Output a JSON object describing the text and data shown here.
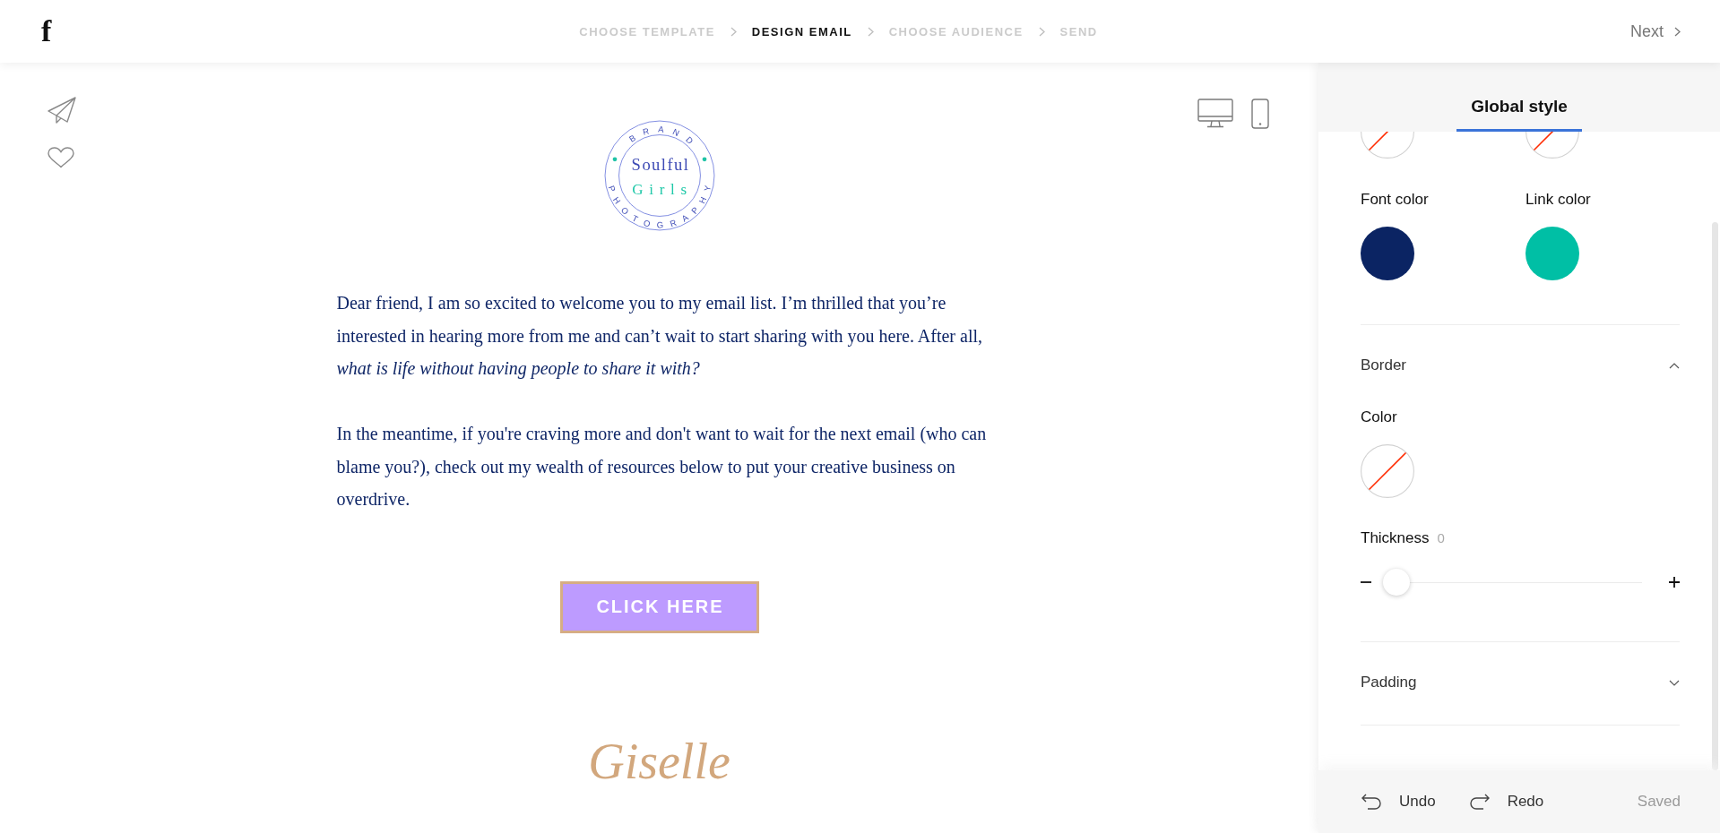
{
  "top_bar": {
    "logo": "f",
    "steps": [
      {
        "label": "CHOOSE TEMPLATE",
        "selected": false
      },
      {
        "label": "DESIGN EMAIL",
        "selected": true
      },
      {
        "label": "CHOOSE AUDIENCE",
        "selected": false
      },
      {
        "label": "SEND",
        "selected": false
      }
    ],
    "next_button": "Next"
  },
  "email": {
    "logo": {
      "arc_top": "BRAND",
      "line_1": "Soulful",
      "line_2": "Girls",
      "arc_bottom": "PHOTOGRAPHY"
    },
    "paragraphs": [
      "Dear friend, I am so excited to welcome you to my email list. I’m thrilled that you’re interested in hearing more from me and can’t wait to start sharing with you here. After all, *what is life without having people to share it with?*",
      "In the meantime, if you're craving more and don't want to wait for the next email (who can blame you?), check out my wealth of resources below to put your creative business on overdrive."
    ],
    "button": "CLICK HERE",
    "signature": "Giselle"
  },
  "style_panel": {
    "tabs": [
      {
        "label": "Global style",
        "selected": true
      }
    ],
    "partial_swatches": [
      {
        "kind": "none"
      },
      {
        "kind": "none"
      }
    ],
    "color_settings": [
      {
        "label": "Font color",
        "swatch": {
          "kind": "color",
          "color": "#0b2463"
        }
      },
      {
        "label": "Link color",
        "swatch": {
          "kind": "color",
          "color": "#00bfa5"
        }
      }
    ],
    "sections": [
      {
        "title": "Border",
        "expanded": true,
        "fields": [
          {
            "kind": "swatch",
            "label": "Color",
            "swatch": {
              "kind": "none"
            }
          },
          {
            "kind": "slider",
            "label": "Thickness",
            "reading": "0",
            "level": 0
          }
        ]
      },
      {
        "title": "Padding",
        "expanded": false
      }
    ],
    "footer": {
      "undo": "Undo",
      "redo": "Redo",
      "status": "Saved"
    }
  }
}
